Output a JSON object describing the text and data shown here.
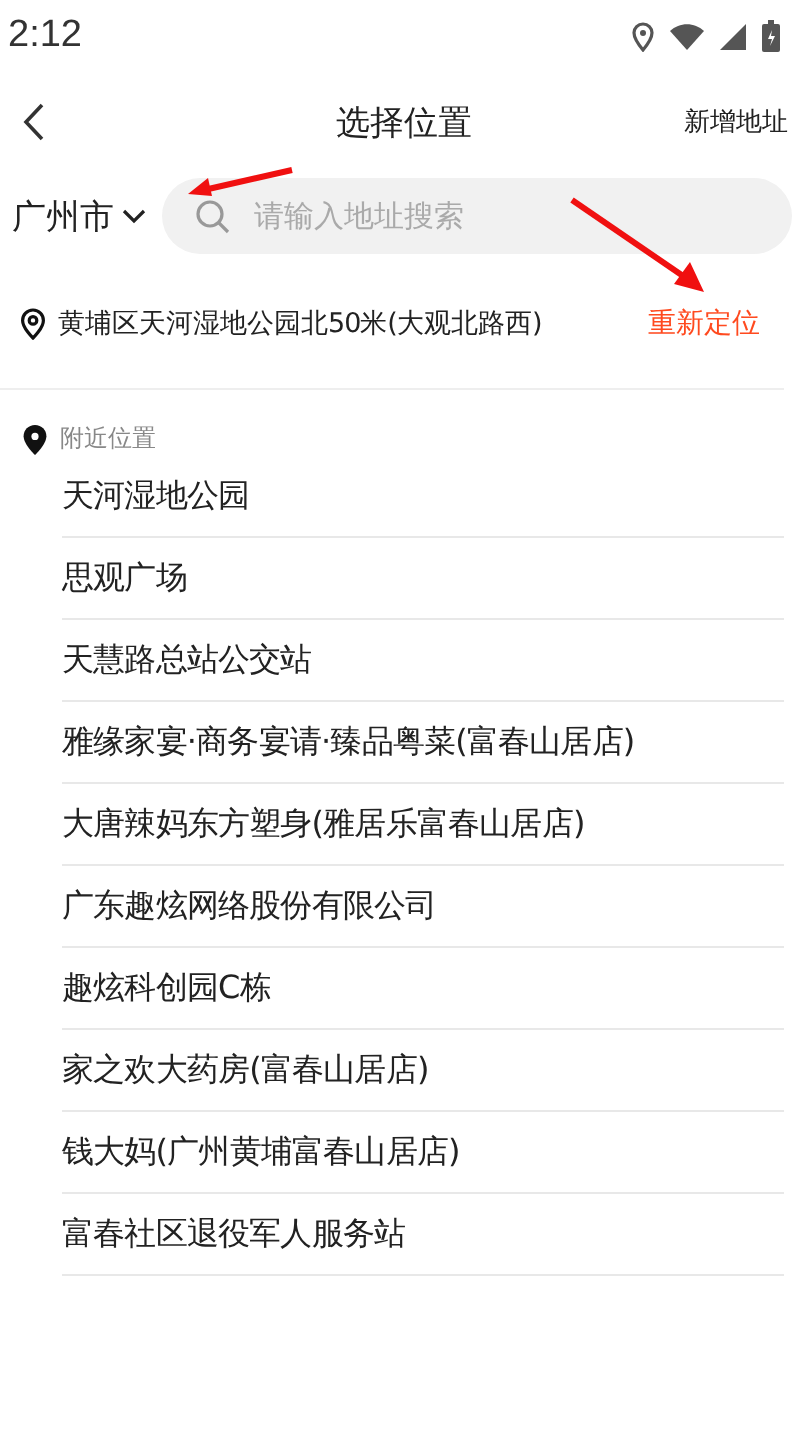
{
  "status_bar": {
    "time": "2:12"
  },
  "header": {
    "title": "选择位置",
    "action": "新增地址"
  },
  "search": {
    "city": "广州市",
    "placeholder": "请输入地址搜索"
  },
  "current_location": {
    "address": "黄埔区天河湿地公园北50米(大观北路西)",
    "action": "重新定位"
  },
  "nearby": {
    "heading": "附近位置",
    "items": [
      "天河湿地公园",
      "思观广场",
      "天慧路总站公交站",
      "雅缘家宴·商务宴请·臻品粤菜(富春山居店)",
      "大唐辣妈东方塑身(雅居乐富春山居店)",
      "广东趣炫网络股份有限公司",
      "趣炫科创园C栋",
      "家之欢大药房(富春山居店)",
      "钱大妈(广州黄埔富春山居店)",
      "富春社区退役军人服务站"
    ]
  }
}
